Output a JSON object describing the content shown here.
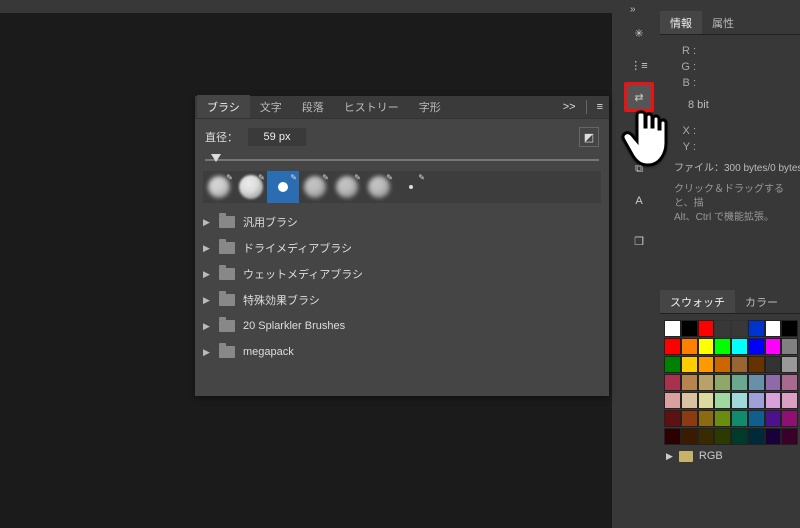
{
  "topChevrons": "»",
  "dock": {
    "items": [
      {
        "name": "navigator-icon",
        "glyph": "✳"
      },
      {
        "name": "brush-settings-icon",
        "glyph": "⋮≡"
      },
      {
        "name": "sliders-icon",
        "glyph": "⇄",
        "highlight": true
      },
      {
        "name": "guide-icon",
        "glyph": "✛"
      },
      {
        "name": "ruler-icon",
        "glyph": "⧉"
      },
      {
        "name": "type-icon",
        "glyph": "A"
      },
      {
        "name": "layers-icon",
        "glyph": "❐"
      }
    ]
  },
  "info": {
    "tabs": [
      {
        "label": "情報",
        "active": true
      },
      {
        "label": "属性",
        "active": false
      }
    ],
    "channels": [
      "R :",
      "G :",
      "B :"
    ],
    "bit": "8 bit",
    "coords": [
      "X :",
      "Y :"
    ],
    "file": "ファイル：300 bytes/0 bytes",
    "hint1": "クリック＆ドラッグすると、描",
    "hint2": "Alt、Ctrl で機能拡張。"
  },
  "swatches": {
    "tabs": [
      {
        "label": "スウォッチ",
        "active": true
      },
      {
        "label": "カラー",
        "active": false
      }
    ],
    "rows": [
      [
        "#ffffff",
        "#000000",
        "#ff0000",
        "",
        "",
        "#0033cc",
        "#ffffff",
        "#000000"
      ],
      [
        "#ff0000",
        "#ff7f00",
        "#ffff00",
        "#00ff00",
        "#00ffff",
        "#0000ff",
        "#ff00ff",
        "#808080"
      ],
      [
        "#008000",
        "#ffcc00",
        "#ff9900",
        "#cc6600",
        "#996633",
        "#663300",
        "#333333",
        "#999999"
      ],
      [
        "#a6324d",
        "#b8844d",
        "#b8a26a",
        "#8fa86a",
        "#6aa88f",
        "#6a8fa8",
        "#8f6aa8",
        "#a86a8f"
      ],
      [
        "#d9a0a0",
        "#d9c2a0",
        "#d9d9a0",
        "#a0d9a0",
        "#a0d9d9",
        "#a0a0d9",
        "#d9a0d9",
        "#d9a0c2"
      ],
      [
        "#5e1111",
        "#8c3a11",
        "#8c6a11",
        "#6a8c11",
        "#118c6a",
        "#115e8c",
        "#4d118c",
        "#8c1171"
      ],
      [
        "#2a0000",
        "#3a1a00",
        "#3a2a00",
        "#2a3a00",
        "#003a2a",
        "#002a3a",
        "#1a003a",
        "#3a002a"
      ]
    ],
    "rgbLabel": "RGB"
  },
  "brushPanel": {
    "tabs": [
      {
        "label": "ブラシ",
        "active": true
      },
      {
        "label": "文字",
        "active": false
      },
      {
        "label": "段落",
        "active": false
      },
      {
        "label": "ヒストリー",
        "active": false
      },
      {
        "label": "字形",
        "active": false
      }
    ],
    "headChevrons": ">>",
    "menuGlyph": "≡",
    "sizeLabel": "直径：",
    "sizeValue": "59 px",
    "folders": [
      {
        "name": "汎用ブラシ"
      },
      {
        "name": "ドライメディアブラシ"
      },
      {
        "name": "ウェットメディアブラシ"
      },
      {
        "name": "特殊効果ブラシ"
      },
      {
        "name": "20 Splarkler Brushes"
      },
      {
        "name": "megapack"
      }
    ]
  }
}
